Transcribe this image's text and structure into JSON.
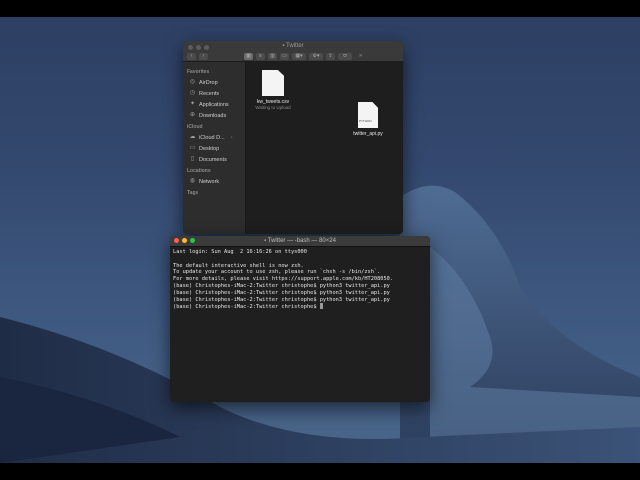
{
  "colors": {
    "desktop_sky": "#34496f",
    "window_dark": "#262626",
    "terminal_bg": "#1f1f1f"
  },
  "finder": {
    "title": "Twitter",
    "toolbar_icons": [
      "back-icon",
      "forward-icon",
      "icon-view-icon",
      "list-view-icon",
      "column-view-icon",
      "gallery-view-icon",
      "group-icon",
      "action-gear-icon",
      "share-icon",
      "tags-icon",
      "more-icon"
    ],
    "sidebar": {
      "favorites_header": "Favorites",
      "favorites": [
        {
          "label": "AirDrop",
          "icon": "airdrop-icon"
        },
        {
          "label": "Recents",
          "icon": "clock-icon"
        },
        {
          "label": "Applications",
          "icon": "applications-icon"
        },
        {
          "label": "Downloads",
          "icon": "download-icon"
        }
      ],
      "icloud_header": "iCloud",
      "icloud": [
        {
          "label": "iCloud D...",
          "icon": "cloud-icon"
        },
        {
          "label": "Desktop",
          "icon": "desktop-icon"
        },
        {
          "label": "Documents",
          "icon": "document-icon"
        }
      ],
      "locations_header": "Locations",
      "locations": [
        {
          "label": "Network",
          "icon": "globe-icon"
        }
      ],
      "tags_header": "Tags"
    },
    "files": [
      {
        "name": "kw_tweets.csv",
        "subtitle": "Waiting to Upload"
      },
      {
        "name": "twitter_api.py",
        "badge": "PYTHON"
      }
    ]
  },
  "terminal": {
    "title": "Twitter — -bash — 80×24",
    "lines": [
      "Last login: Sun Aug  2 16:16:26 on ttys000",
      "",
      "The default interactive shell is now zsh.",
      "To update your account to use zsh, please run `chsh -s /bin/zsh`.",
      "For more details, please visit https://support.apple.com/kb/HT208050.",
      "(base) Christophes-iMac-2:Twitter christophe$ python3 twitter_api.py",
      "(base) Christophes-iMac-2:Twitter christophe$ python3 twitter_api.py",
      "(base) Christophes-iMac-2:Twitter christophe$ python3 twitter_api.py",
      "(base) Christophes-iMac-2:Twitter christophe$ "
    ]
  }
}
